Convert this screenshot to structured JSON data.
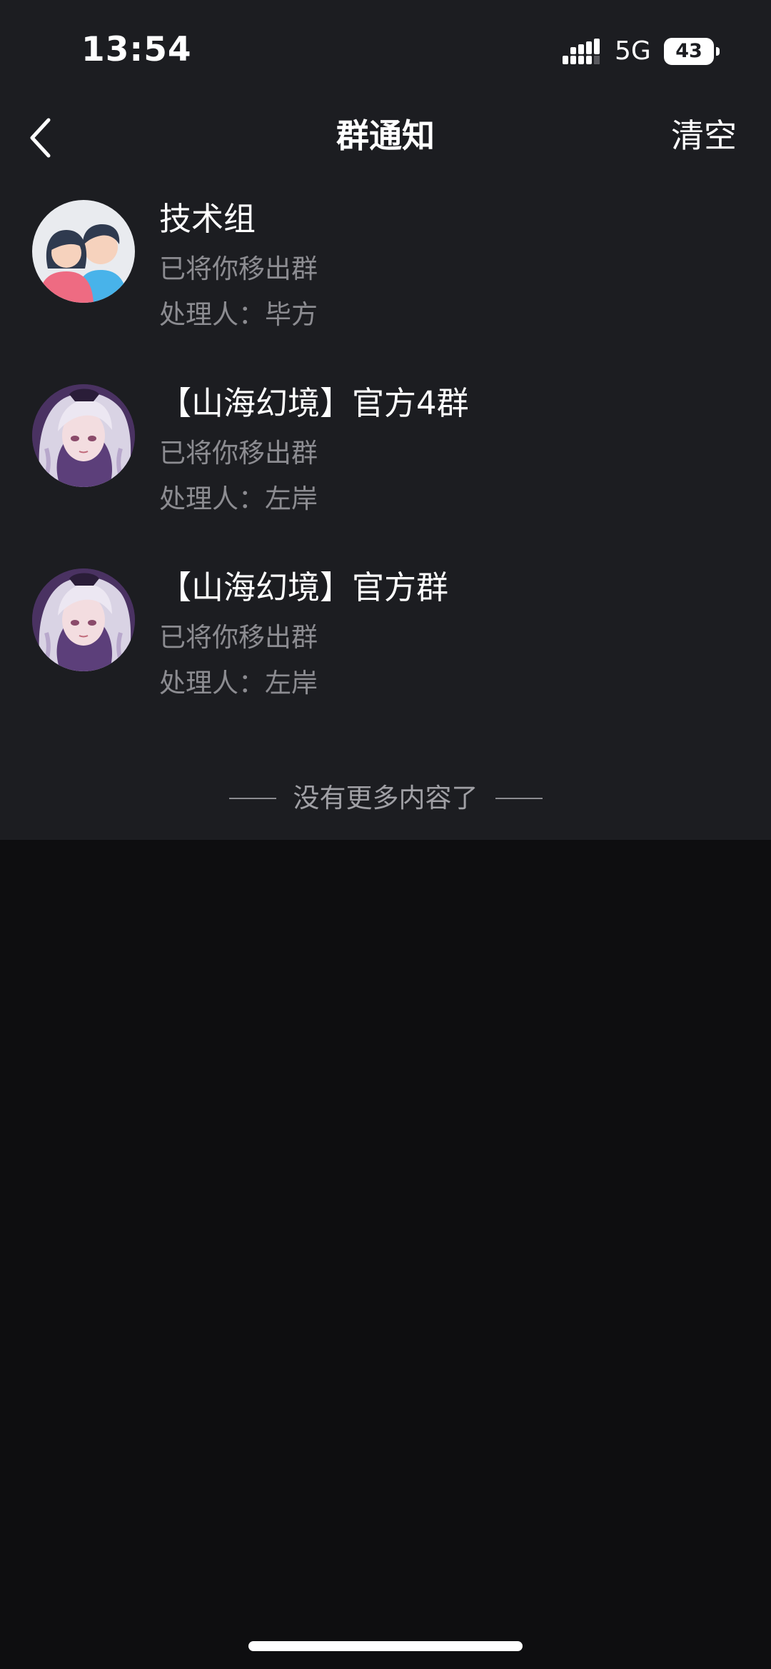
{
  "status_bar": {
    "time": "13:54",
    "signal_icon": "cellular-signal-icon",
    "network": "5G",
    "battery": "43"
  },
  "nav": {
    "back_icon": "chevron-left-icon",
    "title": "群通知",
    "clear_label": "清空"
  },
  "notices": [
    {
      "avatar": "default-group-avatar",
      "group_name": "技术组",
      "action": "已将你移出群",
      "handler": "处理人：毕方"
    },
    {
      "avatar": "anime-character-avatar",
      "group_name": "【山海幻境】官方4群",
      "action": "已将你移出群",
      "handler": "处理人：左岸"
    },
    {
      "avatar": "anime-character-avatar",
      "group_name": "【山海幻境】官方群",
      "action": "已将你移出群",
      "handler": "处理人：左岸"
    }
  ],
  "footer": {
    "end_text": "没有更多内容了"
  },
  "colors": {
    "panel_bg": "#1c1d21",
    "page_bg": "#0e0e10",
    "secondary_text": "#8c8c91",
    "avatar_purple": "#8a6aa8"
  }
}
